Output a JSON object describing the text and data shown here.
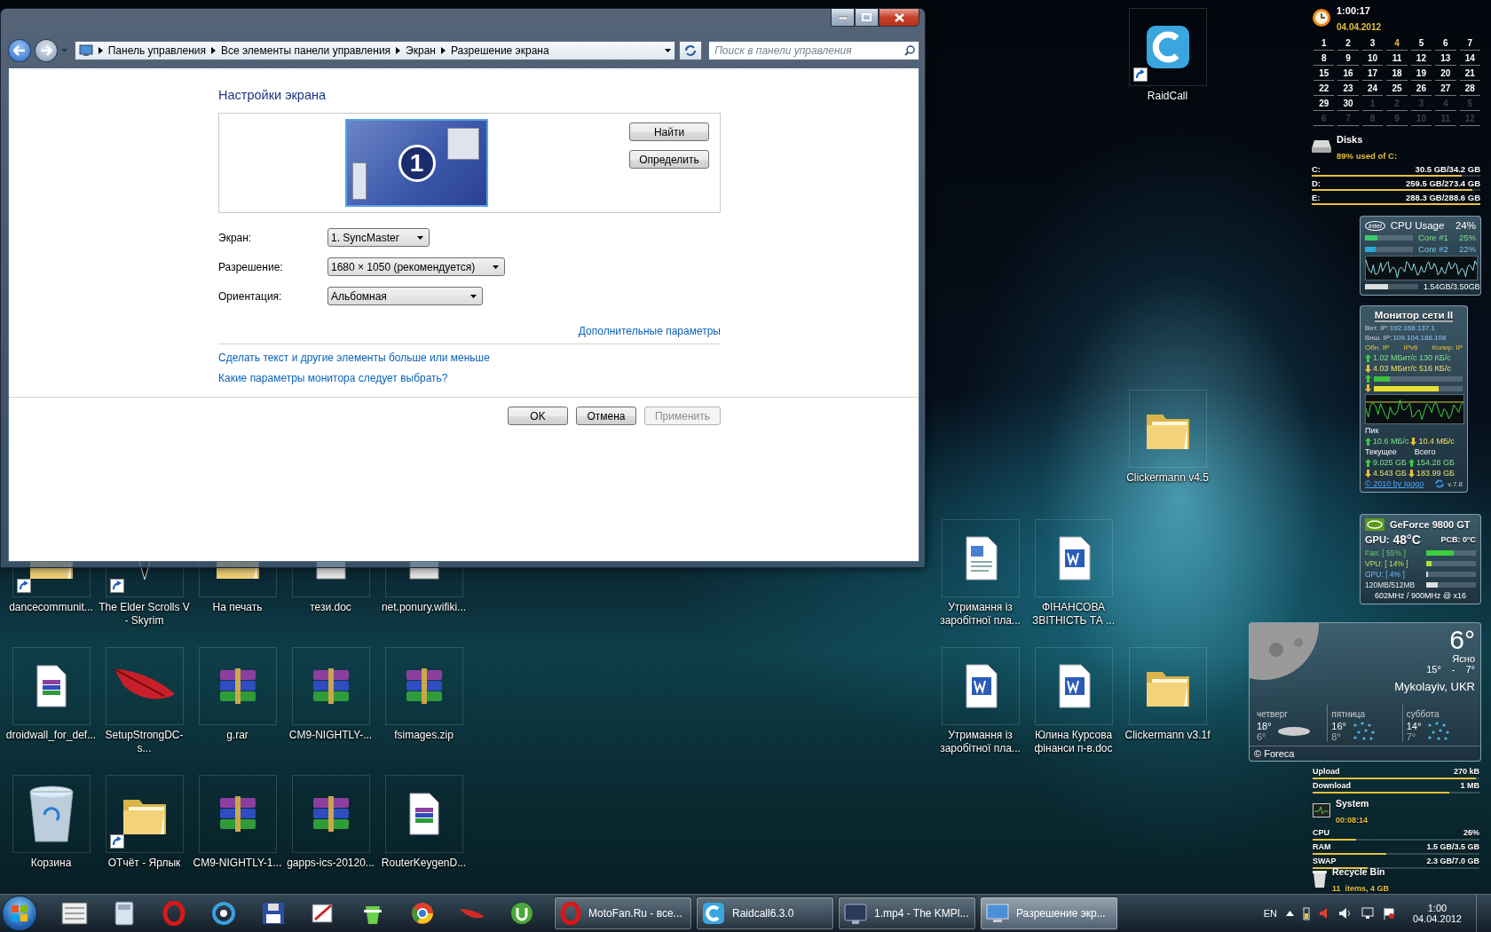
{
  "window": {
    "breadcrumbs": [
      "Панель управления",
      "Все элементы панели управления",
      "Экран",
      "Разрешение экрана"
    ],
    "search": {
      "placeholder": "Поиск в панели управления"
    },
    "heading": "Настройки экрана",
    "monitor": {
      "number": "1"
    },
    "preview_buttons": [
      "Найти",
      "Определить"
    ],
    "settings": [
      {
        "label": "Экран:",
        "value": "1. SyncMaster"
      },
      {
        "label": "Разрешение:",
        "value": "1680 × 1050 (рекомендуется)"
      },
      {
        "label": "Ориентация:",
        "value": "Альбомная"
      }
    ],
    "advanced_link": "Дополнительные параметры",
    "links": [
      "Сделать текст и другие элементы больше или меньше",
      "Какие параметры монитора следует выбрать?"
    ],
    "buttons": [
      {
        "label": "OK",
        "disabled": false
      },
      {
        "label": "Отмена",
        "disabled": false
      },
      {
        "label": "Применить",
        "disabled": true
      }
    ]
  },
  "desktop_icons": [
    {
      "label": "RaidCall",
      "kind": "app",
      "shortcut": true
    },
    {
      "label": "Clickermann v4.5",
      "kind": "folder",
      "shortcut": false
    },
    {
      "label": "dancecommunit...",
      "kind": "folder",
      "shortcut": true
    },
    {
      "label": "The Elder Scrolls V - Skyrim",
      "kind": "emblem",
      "shortcut": true
    },
    {
      "label": "На печать",
      "kind": "folder",
      "shortcut": false
    },
    {
      "label": "тези.doc",
      "kind": "file",
      "shortcut": false
    },
    {
      "label": "net.ponury.wifiki...",
      "kind": "file",
      "shortcut": false
    },
    {
      "label": "Утримання із заробітної пла...",
      "kind": "document",
      "shortcut": false
    },
    {
      "label": "ФІНАНСОВА ЗВІТНІСТЬ ТА ...",
      "kind": "word",
      "shortcut": false
    },
    {
      "label": "droidwall_for_def...",
      "kind": "archive-file",
      "shortcut": false
    },
    {
      "label": "SetupStrongDC-s...",
      "kind": "feather",
      "shortcut": false
    },
    {
      "label": "g.rar",
      "kind": "archive",
      "shortcut": false
    },
    {
      "label": "CM9-NIGHTLY-...",
      "kind": "archive",
      "shortcut": false
    },
    {
      "label": "fsimages.zip",
      "kind": "archive",
      "shortcut": false
    },
    {
      "label": "Утримання із заробітної пла...",
      "kind": "word",
      "shortcut": false
    },
    {
      "label": "Юлина Курсова фінанси п-в.doc",
      "kind": "word",
      "shortcut": false
    },
    {
      "label": "Clickermann v3.1f",
      "kind": "folder",
      "shortcut": false
    },
    {
      "label": "Корзина",
      "kind": "recycle-bin",
      "shortcut": false
    },
    {
      "label": "ОТчёт - Ярлык",
      "kind": "folder",
      "shortcut": true
    },
    {
      "label": "CM9-NIGHTLY-1...",
      "kind": "archive",
      "shortcut": false
    },
    {
      "label": "gapps-ics-20120...",
      "kind": "archive",
      "shortcut": false
    },
    {
      "label": "RouterKeygenD...",
      "kind": "archive-file",
      "shortcut": false
    }
  ],
  "clock": {
    "time": "1:00:17",
    "date": "04.04.2012"
  },
  "calendar": [
    {
      "day": "1",
      "kind": "day"
    },
    {
      "day": "2",
      "kind": "day"
    },
    {
      "day": "3",
      "kind": "day"
    },
    {
      "day": "4",
      "kind": "today"
    },
    {
      "day": "5",
      "kind": "day"
    },
    {
      "day": "6",
      "kind": "day"
    },
    {
      "day": "7",
      "kind": "day"
    },
    {
      "day": "8",
      "kind": "day"
    },
    {
      "day": "9",
      "kind": "day"
    },
    {
      "day": "10",
      "kind": "day"
    },
    {
      "day": "11",
      "kind": "day"
    },
    {
      "day": "12",
      "kind": "day"
    },
    {
      "day": "13",
      "kind": "day"
    },
    {
      "day": "14",
      "kind": "day"
    },
    {
      "day": "15",
      "kind": "day"
    },
    {
      "day": "16",
      "kind": "day"
    },
    {
      "day": "17",
      "kind": "day"
    },
    {
      "day": "18",
      "kind": "day"
    },
    {
      "day": "19",
      "kind": "day"
    },
    {
      "day": "20",
      "kind": "day"
    },
    {
      "day": "21",
      "kind": "day"
    },
    {
      "day": "22",
      "kind": "day"
    },
    {
      "day": "23",
      "kind": "day"
    },
    {
      "day": "24",
      "kind": "day"
    },
    {
      "day": "25",
      "kind": "day"
    },
    {
      "day": "26",
      "kind": "day"
    },
    {
      "day": "27",
      "kind": "day"
    },
    {
      "day": "28",
      "kind": "day"
    },
    {
      "day": "29",
      "kind": "day"
    },
    {
      "day": "30",
      "kind": "day"
    },
    {
      "day": "1",
      "kind": "other"
    },
    {
      "day": "2",
      "kind": "other"
    },
    {
      "day": "3",
      "kind": "other"
    },
    {
      "day": "4",
      "kind": "other"
    },
    {
      "day": "5",
      "kind": "other"
    },
    {
      "day": "6",
      "kind": "other"
    },
    {
      "day": "7",
      "kind": "other"
    },
    {
      "day": "8",
      "kind": "other"
    },
    {
      "day": "9",
      "kind": "other"
    },
    {
      "day": "10",
      "kind": "other"
    },
    {
      "day": "11",
      "kind": "other"
    },
    {
      "day": "12",
      "kind": "other"
    }
  ],
  "disks": {
    "title": "Disks",
    "subtitle": "89% used of C:",
    "drives": [
      {
        "name": "C:",
        "usage": "30.5 GB/34.2 GB",
        "level": 0.89
      },
      {
        "name": "D:",
        "usage": "259.5 GB/273.4 GB",
        "level": 0.95
      },
      {
        "name": "E:",
        "usage": "288.3 GB/288.6 GB",
        "level": 1.0
      }
    ]
  },
  "cpu": {
    "logo": "intel",
    "title": "CPU Usage",
    "total": "24%",
    "cores": [
      {
        "name": "Core #1",
        "value": "25%",
        "level": 0.25
      },
      {
        "name": "Core #2",
        "value": "22%",
        "level": 0.22
      }
    ],
    "memory": {
      "text": "1.54GB/3.50GB",
      "level": 0.44
    }
  },
  "network": {
    "title": "Монитор сети II",
    "ips": [
      {
        "label": "Внт. IP:",
        "value": "192.168.137.1"
      },
      {
        "label": "Внш. IP:",
        "value": "109.104.186.108"
      }
    ],
    "actions": [
      "Обн. IP",
      "IPv6",
      "Копир. IP"
    ],
    "upload": {
      "text": "1.02 МБит/с 130 КБ/с",
      "level": 0.18
    },
    "download": {
      "text": "4.03 МБит/с 516 КБ/с",
      "level": 0.73
    },
    "peak_label": "Пик",
    "peak_up": "10.6 МБ/с",
    "peak_down": "10.4 МБ/с",
    "current_label": "Текущее",
    "total_label": "Всего",
    "current_up": "9.025 GБ",
    "total_up": "154.28 GБ",
    "current_down": "4.543 GБ",
    "total_down": "183.99 GБ",
    "credit": "© 2010 by Igogo",
    "version": "v.7.8"
  },
  "gpu": {
    "title": "GeForce 9800 GT",
    "label": "GPU:",
    "temperature": "48°C",
    "pcb": "PCB: 0°C",
    "meters": [
      {
        "label": "Fan: [ 55% ]",
        "level": 0.55
      },
      {
        "label": "VPU: [ 14% ]",
        "level": 0.1
      },
      {
        "label": "GPU: [ 4% ]",
        "level": 0.04
      },
      {
        "label": "120MB/512MB",
        "level": 0.23
      }
    ],
    "clocks": "602MHz / 900MHz @ x16"
  },
  "weather": {
    "temperature": "6°",
    "condition": "Ясно",
    "high": "15°",
    "separator": "-",
    "low": "7°",
    "location": "Mykolayiv, UKR",
    "forecast": [
      {
        "day": "четверг",
        "high": "18°",
        "low": "6°",
        "kind": "cloudy"
      },
      {
        "day": "пятница",
        "high": "16°",
        "low": "8°",
        "kind": "rain"
      },
      {
        "day": "суббота",
        "high": "14°",
        "low": "7°",
        "kind": "rain"
      }
    ],
    "credit": "© Foreca"
  },
  "system_meter": {
    "traffic": [
      {
        "label": "Upload",
        "value": "270 kB",
        "level": 0.98
      },
      {
        "label": "Download",
        "value": "1 MB",
        "level": 0.82
      }
    ],
    "title": "System",
    "uptime": "00:08:14",
    "meters": [
      {
        "label": "CPU",
        "value": "26%",
        "level": 0.26
      },
      {
        "label": "RAM",
        "value": "1.5 GB/3.5 GB",
        "level": 0.44
      },
      {
        "label": "SWAP",
        "value": "2.3 GB/7.0 GB",
        "level": 0.33
      }
    ]
  },
  "recycle_bin": {
    "title": "Recycle Bin",
    "info": "11  items, 4 GB"
  },
  "taskbar": {
    "tasks": [
      {
        "label": "MotoFan.Ru - все...",
        "selected": false
      },
      {
        "label": "Raidcall6.3.0",
        "selected": false
      },
      {
        "label": "1.mp4 - The KMPl...",
        "selected": false
      },
      {
        "label": "Разрешение экр...",
        "selected": true
      }
    ],
    "language": "EN",
    "time": "1:00",
    "date": "04.04.2012"
  }
}
